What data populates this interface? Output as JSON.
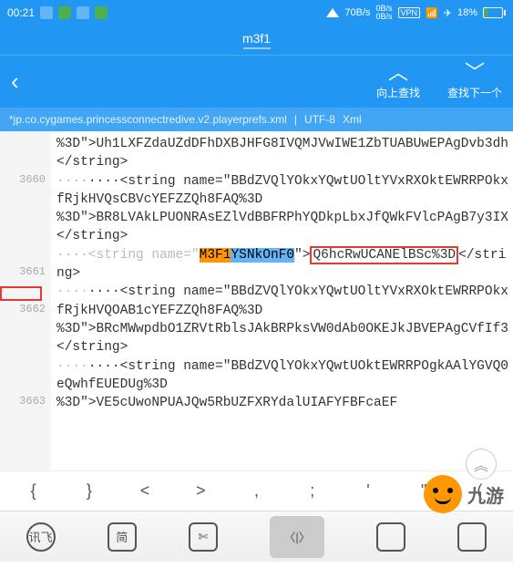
{
  "status": {
    "time": "00:21",
    "speed": "70B/s",
    "up": "0B/s",
    "down": "0B/s",
    "vpn": "VPN",
    "battery": "18%"
  },
  "title": "m3f1",
  "nav": {
    "up": "向上查找",
    "next": "查找下一个"
  },
  "fileinfo": {
    "path": "*jp.co.cygames.princessconnectredive.v2.playerprefs.xml",
    "sep1": "|",
    "enc": "UTF-8",
    "fmt": "Xml"
  },
  "lines": {
    "l1": "%3D\">Uh1LXFZdaUZdDFhDXBJHFG8IVQMJVwIWE1ZbTUABUwEPAgDvb3dh</string>",
    "l2a": "····<string name=\"BBdZVQlYOkxYQwtUOltYVxRXOktEWRRPOkxfRjkHVQsCBVcYEFZZQh8FAQ%3D",
    "l2b": "%3D\">BR8LVAkLPUONRAsEZlVdBBFRPhYQDkpLbxJfQWkFVlcPAgB7y3IX</string>",
    "l3a": "····<string name=\"",
    "l3_hl1": "M3F1",
    "l3_hl2": "YSNkOnF0",
    "l3b": "\">",
    "l3_box": "Q6hcRwUCANElBSc%3D",
    "l3c": "</string>",
    "l4a": "····<string name=\"BBdZVQlYOkxYQwtUOltYVxRXOktEWRRPOkxfRjkHVQOAB1cYEFZZQh8FAQ%3D",
    "l4b": "%3D\">BRcMWwpdbO1ZRVtRblsJAkBRPksVW0dAb0OKEJkJBVEPAgCVfIf3</string>",
    "l5a": "····<string name=\"BBdZVQlYOkxYQwtUOktEWRRPOgkAAlYGVQ0eQwhfEUEDUg%3D",
    "l5b": "%3D\">VE5cUwoNPUAJQw5RbUZFXRYdalUIAFYFBFcaEF",
    "ln_3660": "3660",
    "ln_3661": "3661",
    "ln_3662": "3662",
    "ln_3663": "3663"
  },
  "symbols": {
    "s1": "{",
    "s2": "}",
    "s3": "<",
    "s4": ">",
    "s5": ",",
    "s6": ";",
    "s7": "'",
    "s8": "\"",
    "s9": "("
  },
  "toolbar": {
    "t1": "讯飞",
    "t2": "简",
    "t3": "✄"
  },
  "watermark": "九游"
}
